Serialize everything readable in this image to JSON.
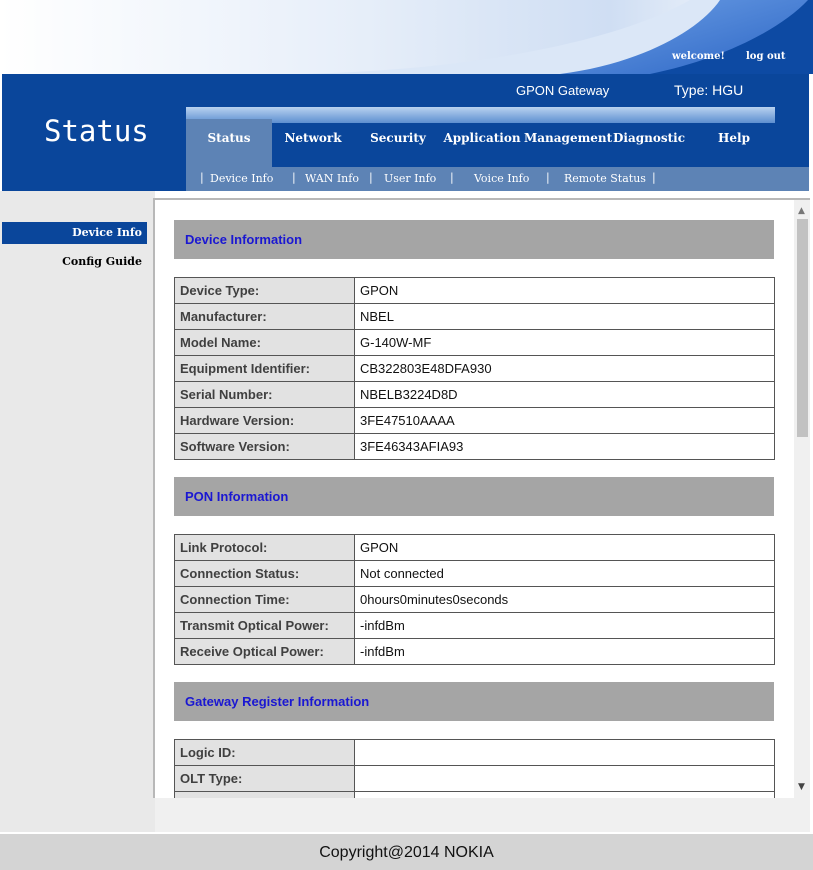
{
  "banner": {
    "welcome": "welcome!",
    "logout": "log out"
  },
  "header": {
    "product": "GPON Gateway",
    "type": "Type: HGU",
    "page_title": "Status"
  },
  "nav": {
    "tabs": [
      {
        "label": "Status",
        "active": true
      },
      {
        "label": "Network",
        "active": false
      },
      {
        "label": "Security",
        "active": false
      },
      {
        "label": "Application",
        "active": false
      },
      {
        "label": "Management",
        "active": false
      },
      {
        "label": "Diagnostic",
        "active": false
      },
      {
        "label": "Help",
        "active": false
      }
    ],
    "sub_items": [
      {
        "label": "Device Info"
      },
      {
        "label": "WAN Info"
      },
      {
        "label": "User Info"
      },
      {
        "label": "Voice Info"
      },
      {
        "label": "Remote Status"
      }
    ]
  },
  "sidebar": {
    "items": [
      {
        "label": "Device Info",
        "active": true
      },
      {
        "label": "Config Guide",
        "active": false
      }
    ]
  },
  "sections": {
    "device": {
      "title": "Device Information",
      "rows": [
        {
          "label": "Device Type:",
          "value": "GPON"
        },
        {
          "label": "Manufacturer:",
          "value": "NBEL"
        },
        {
          "label": "Model Name:",
          "value": "G-140W-MF"
        },
        {
          "label": "Equipment Identifier:",
          "value": "CB322803E48DFA930"
        },
        {
          "label": "Serial Number:",
          "value": "NBELB3224D8D"
        },
        {
          "label": "Hardware Version:",
          "value": "3FE47510AAAA"
        },
        {
          "label": "Software Version:",
          "value": "3FE46343AFIA93"
        }
      ]
    },
    "pon": {
      "title": "PON Information",
      "rows": [
        {
          "label": "Link Protocol:",
          "value": "GPON"
        },
        {
          "label": "Connection Status:",
          "value": "Not connected"
        },
        {
          "label": "Connection Time:",
          "value": "0hours0minutes0seconds"
        },
        {
          "label": "Transmit Optical Power:",
          "value": "-infdBm"
        },
        {
          "label": "Receive Optical Power:",
          "value": "-infdBm"
        }
      ]
    },
    "gateway": {
      "title": "Gateway Register Information",
      "rows": [
        {
          "label": "Logic ID:",
          "value": ""
        },
        {
          "label": "OLT Type:",
          "value": ""
        },
        {
          "label": "",
          "value": ""
        }
      ]
    }
  },
  "footer": {
    "copyright": "Copyright@2014 NOKIA"
  },
  "colors": {
    "brand_blue": "#0a469b",
    "nav_active": "#5d83b5",
    "section_header": "#a5a5a5",
    "section_title": "#1a17d2"
  }
}
